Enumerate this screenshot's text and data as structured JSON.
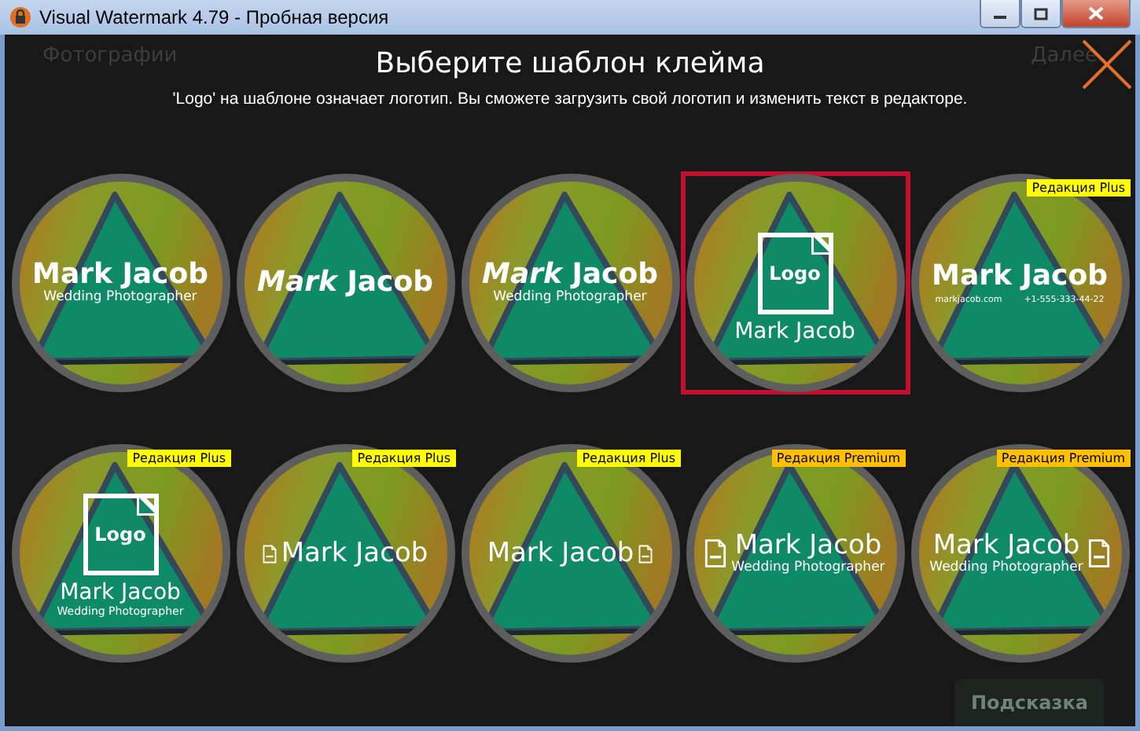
{
  "window": {
    "title": "Visual Watermark 4.79 - Пробная версия"
  },
  "backdrop": {
    "back_link": "Фотографии",
    "next_link": "Далее",
    "hint_button": "Подсказка"
  },
  "dialog": {
    "title": "Выберите шаблон клейма",
    "subtitle": "'Logo' на шаблоне означает логотип. Вы сможете загрузить свой логотип и изменить текст в редакторе."
  },
  "templates": [
    {
      "kind": "stacked",
      "name": "Mark Jacob",
      "name_bold": true,
      "subtitle": "Wedding Photographer",
      "selected": false
    },
    {
      "kind": "name-only",
      "name": "*Mark* Jacob",
      "name_bold": true,
      "selected": false
    },
    {
      "kind": "stacked",
      "name": "*Mark* Jacob",
      "name_bold": true,
      "subtitle": "Wedding Photographer",
      "selected": false
    },
    {
      "kind": "logo-top",
      "logo": "Logo",
      "name": "Mark Jacob",
      "name_bold": false,
      "selected": true
    },
    {
      "kind": "contacts",
      "name": "Mark Jacob",
      "name_bold": true,
      "website": "markjacob.com",
      "phone": "+1-555-333-44-22",
      "selected": false,
      "badge": {
        "text": "Редакция Plus",
        "color": "#ffff00"
      }
    },
    {
      "kind": "logo-top",
      "logo": "Logo",
      "name": "Mark Jacob",
      "name_bold": false,
      "subtitle": "Wedding Photographer",
      "selected": false,
      "badge": {
        "text": "Редакция Plus",
        "color": "#ffff00"
      }
    },
    {
      "kind": "icon-left",
      "name": "Mark Jacob",
      "name_bold": false,
      "selected": false,
      "badge": {
        "text": "Редакция Plus",
        "color": "#ffff00"
      }
    },
    {
      "kind": "icon-right",
      "name": "Mark Jacob",
      "name_bold": false,
      "selected": false,
      "badge": {
        "text": "Редакция Plus",
        "color": "#ffff00"
      }
    },
    {
      "kind": "icon-left",
      "name": "Mark Jacob",
      "name_bold": false,
      "subtitle": "Wedding Photographer",
      "selected": false,
      "badge": {
        "text": "Редакция Premium",
        "color": "#ffc000"
      }
    },
    {
      "kind": "icon-right",
      "name": "Mark Jacob",
      "name_bold": false,
      "subtitle": "Wedding Photographer",
      "selected": false,
      "badge": {
        "text": "Редакция Premium",
        "color": "#ffc000"
      }
    }
  ]
}
